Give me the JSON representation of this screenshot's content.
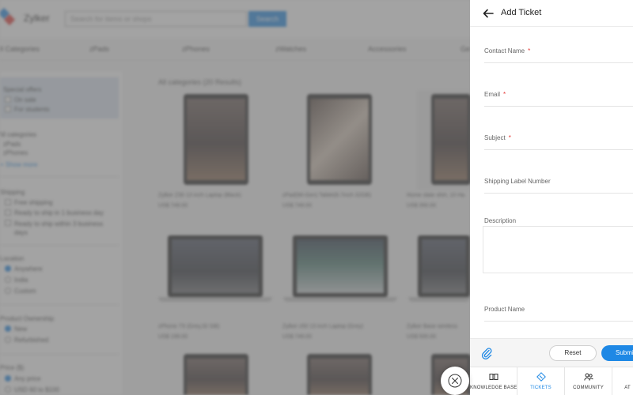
{
  "store": {
    "logo_text": "Zylker",
    "search_placeholder": "Search for items or shops",
    "search_button": "Search",
    "categories": [
      "All Categories",
      "zPads",
      "zPhones",
      "zWatches",
      "Accessories",
      "Ge"
    ],
    "sidebar": {
      "special_offers": "Special offers",
      "on_sale": "On sale",
      "for_students": "For students",
      "all_categories": "All categories",
      "cat_items": [
        "zPads",
        "zPhones"
      ],
      "show_more": "+ Show more",
      "shipping": "Shipping",
      "free_shipping": "Free shipping",
      "ready_1day": "Ready to ship in 1 business day",
      "ready_3days": "Ready to ship within 3 business days",
      "location": "Location",
      "anywhere": "Anywhere",
      "india": "India",
      "custom": "Custom",
      "ownership": "Product Ownership",
      "new": "New",
      "refurbished": "Refurbished",
      "price": "Price ($)",
      "any_price": "Any price",
      "usd_range": "USD 60 to $100"
    },
    "results_label": "All categories (20 Results)",
    "products": [
      {
        "title": "Zylker Z30 13 inch Laptop (Black)",
        "price": "US$ 749.00"
      },
      {
        "title": "zPad(Wi-Gen) Tablet(8.7inch 32GB)",
        "price": "US$ 749.00"
      },
      {
        "title": "Home slate shirt, 10 Ha",
        "price": "US$ 350.00"
      },
      {
        "title": "zPhone 7S (Grey,32 GB)",
        "price": "US$ 199.00"
      },
      {
        "title": "Zylker z50 13 inch Laptop (Grey)",
        "price": "US$ 749.00"
      },
      {
        "title": "Zylker Base wireless",
        "price": "US$ 500.00"
      }
    ]
  },
  "panel": {
    "title": "Add Ticket",
    "fields": [
      {
        "label": "Contact Name",
        "required": "*"
      },
      {
        "label": "Email",
        "required": "*"
      },
      {
        "label": "Subject",
        "required": "*"
      },
      {
        "label": "Shipping Label Number",
        "required": ""
      },
      {
        "label": "Description",
        "required": ""
      },
      {
        "label": "Product Name",
        "required": ""
      }
    ],
    "reset_label": "Reset",
    "submit_label": "Submit",
    "tabs": [
      {
        "label": "KNOWLEDGE BASE",
        "icon": "book-icon"
      },
      {
        "label": "TICKETS",
        "icon": "ticket-icon"
      },
      {
        "label": "COMMUNITY",
        "icon": "community-icon"
      },
      {
        "label": "AT",
        "icon": "chat-icon"
      }
    ]
  },
  "colors": {
    "accent": "#1e88e5",
    "required": "#e53935"
  }
}
